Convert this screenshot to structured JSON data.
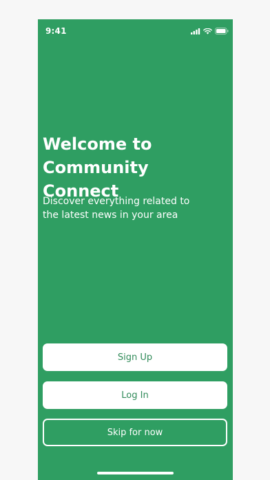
{
  "status_bar": {
    "time": "9:41",
    "icons": [
      "cellular-signal-icon",
      "wifi-icon",
      "battery-icon"
    ]
  },
  "welcome": {
    "title": "Welcome to Community Connect",
    "subtitle": "Discover everything related to the latest news in your area"
  },
  "actions": {
    "sign_up_label": "Sign Up",
    "log_in_label": "Log In",
    "skip_label": "Skip for now"
  },
  "colors": {
    "background": "#2f9e62",
    "button_fill": "#ffffff",
    "button_text": "#2f8a58",
    "text": "#ffffff"
  }
}
